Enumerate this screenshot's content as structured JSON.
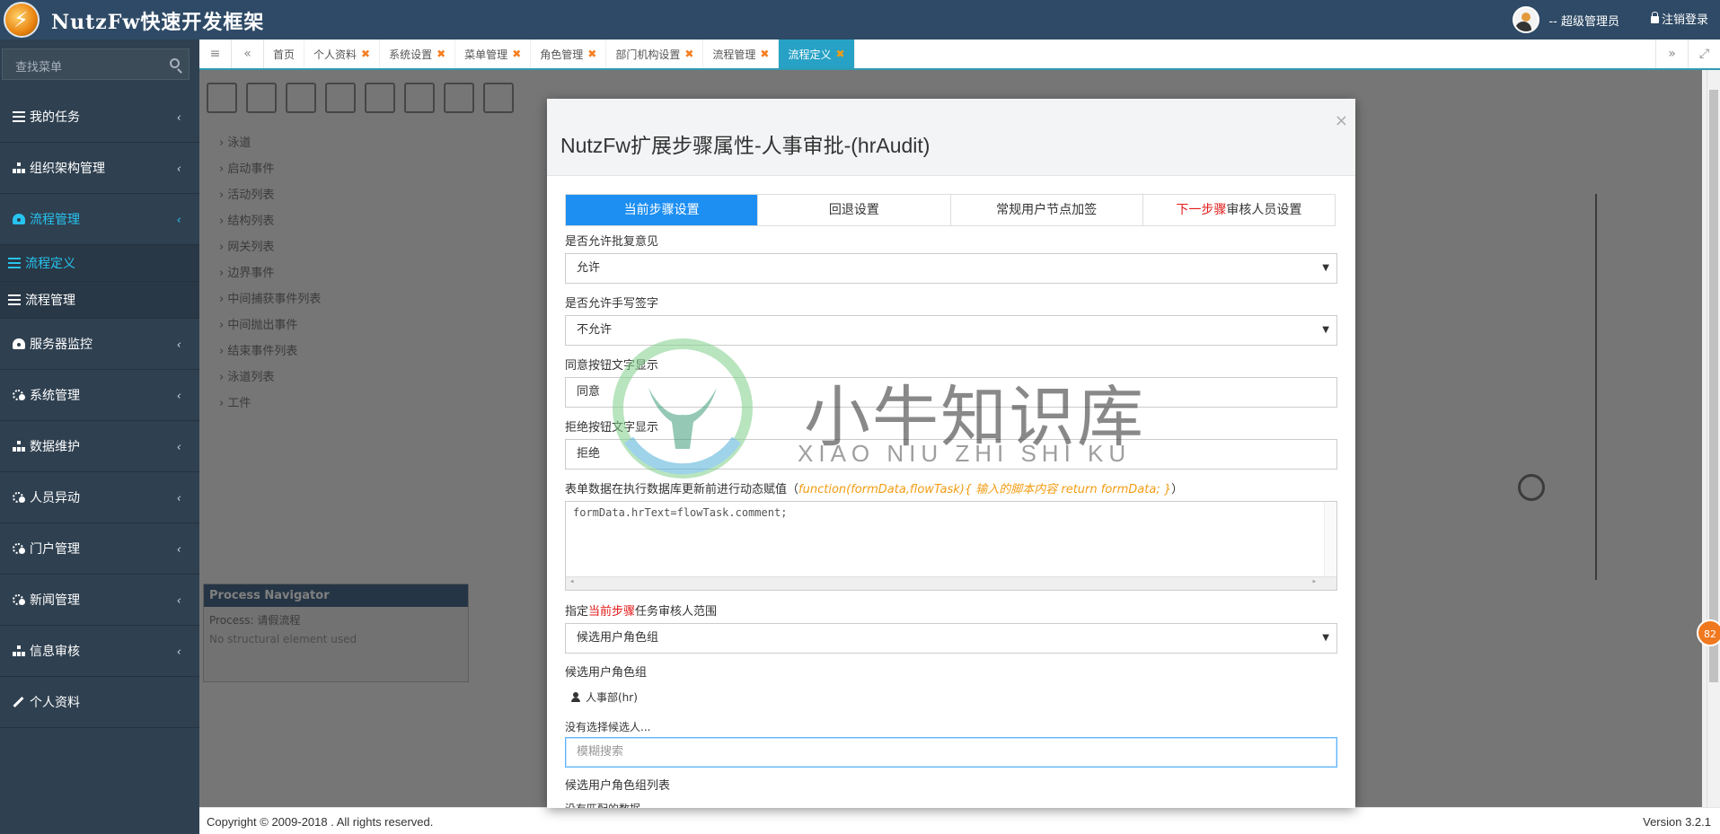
{
  "app": {
    "brand": "NutzFw快速开发框架"
  },
  "header": {
    "user_label": "-- 超级管理员",
    "logout_label": "注销登录"
  },
  "sidebar": {
    "search_placeholder": "查找菜单",
    "items": [
      {
        "label": "我的任务",
        "icon": "list-icon"
      },
      {
        "label": "组织架构管理",
        "icon": "sitemap-icon"
      },
      {
        "label": "流程管理",
        "icon": "dashboard-icon",
        "active": true,
        "children": [
          {
            "label": "流程定义",
            "current": true
          },
          {
            "label": "流程管理"
          }
        ]
      },
      {
        "label": "服务器监控",
        "icon": "dashboard-icon"
      },
      {
        "label": "系统管理",
        "icon": "cogs-icon"
      },
      {
        "label": "数据维护",
        "icon": "sitemap-icon"
      },
      {
        "label": "人员异动",
        "icon": "cogs-icon"
      },
      {
        "label": "门户管理",
        "icon": "cogs-icon"
      },
      {
        "label": "新闻管理",
        "icon": "cogs-icon"
      },
      {
        "label": "信息审核",
        "icon": "sitemap-icon"
      },
      {
        "label": "个人资料",
        "icon": "wrench-icon"
      }
    ]
  },
  "tabs": [
    {
      "label": "首页",
      "closable": false
    },
    {
      "label": "个人资料",
      "closable": true
    },
    {
      "label": "系统设置",
      "closable": true
    },
    {
      "label": "菜单管理",
      "closable": true
    },
    {
      "label": "角色管理",
      "closable": true
    },
    {
      "label": "部门机构设置",
      "closable": true
    },
    {
      "label": "流程管理",
      "closable": true
    },
    {
      "label": "流程定义",
      "closable": true,
      "active": true
    }
  ],
  "background": {
    "tree_items": [
      "泳道",
      "启动事件",
      "活动列表",
      "结构列表",
      "网关列表",
      "边界事件",
      "中间捕获事件列表",
      "中间抛出事件",
      "结束事件列表",
      "泳道列表",
      "工件"
    ],
    "navigator_title": "Process Navigator",
    "navigator_process": "Process: 请假流程",
    "navigator_note": "No structural element used"
  },
  "modal": {
    "title": "NutzFw扩展步骤属性-人事审批-(hrAudit)",
    "close": "×",
    "tabs": [
      {
        "label": "当前步骤设置",
        "active": true
      },
      {
        "label": "回退设置"
      },
      {
        "label": "常规用户节点加签"
      },
      {
        "label_red": "下一步骤",
        "label_rest": "审核人员设置"
      }
    ],
    "fields": {
      "allow_comment_label": "是否允许批复意见",
      "allow_comment_value": "允许",
      "allow_sign_label": "是否允许手写签字",
      "allow_sign_value": "不允许",
      "agree_text_label": "同意按钮文字显示",
      "agree_text_value": "同意",
      "reject_text_label": "拒绝按钮文字显示",
      "reject_text_value": "拒绝",
      "script_label": "表单数据在执行数据库更新前进行动态赋值",
      "script_hint": "function(formData,flowTask){ 输入的脚本内容 return formData; }",
      "script_value": "formData.hrText=flowTask.comment;",
      "range_label_prefix": "指定",
      "range_label_red": "当前步骤",
      "range_label_suffix": "任务审核人范围",
      "range_value": "候选用户角色组",
      "candidate_group_label": "候选用户角色组",
      "candidate_group_item": "人事部(hr)",
      "no_candidate_text": "没有选择候选人...",
      "fuzzy_search_placeholder": "模糊搜索",
      "candidate_list_label": "候选用户角色组列表",
      "no_match_text": "没有匹配的数据"
    }
  },
  "footer": {
    "copyright": "Copyright © 2009-2018 . All rights reserved.",
    "version": "Version 3.2.1"
  },
  "badge_count": "82",
  "watermark": {
    "cn": "小牛知识库",
    "en": "XIAO NIU ZHI SHI KU"
  },
  "colors": {
    "topbar": "#2e4a66",
    "sidebar": "#2f4050",
    "accent": "#27c4f0",
    "active_tab": "#1e8ff2"
  }
}
